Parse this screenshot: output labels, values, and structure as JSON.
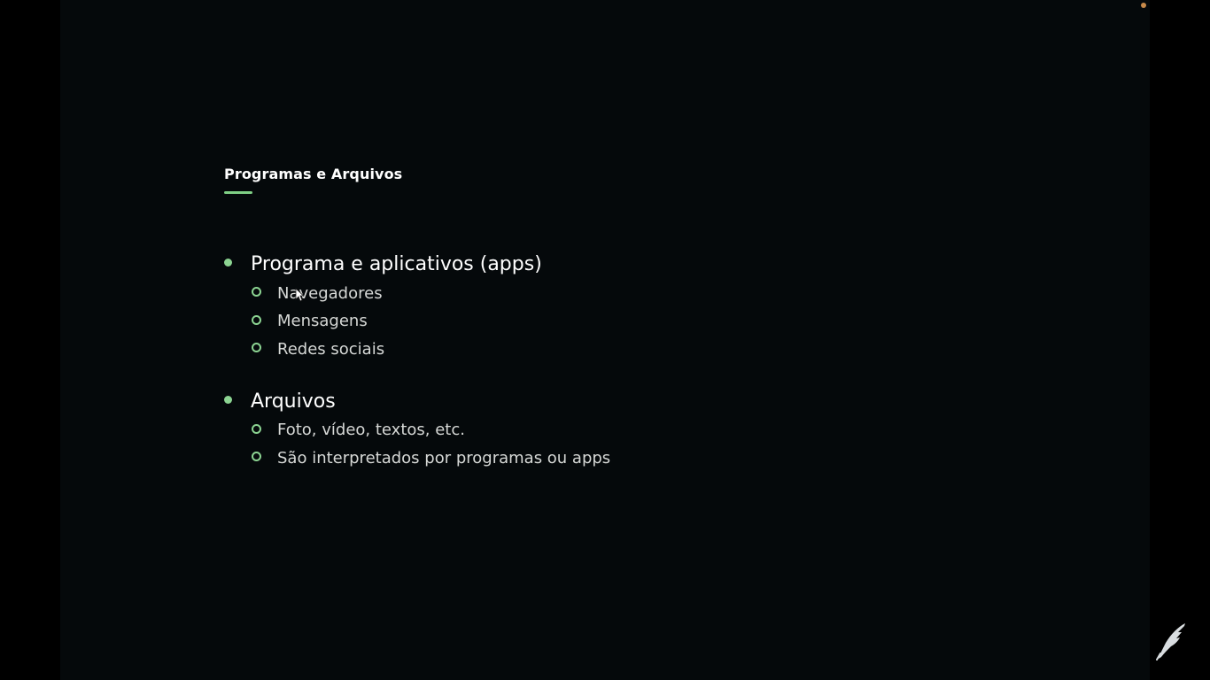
{
  "slide": {
    "title": "Programas e Arquivos",
    "sections": [
      {
        "label": "Programa e aplicativos (apps)",
        "items": [
          "Navegadores",
          "Mensagens",
          "Redes sociais"
        ]
      },
      {
        "label": "Arquivos",
        "items": [
          "Foto, vídeo, textos, etc.",
          "São interpretados por programas ou apps"
        ]
      }
    ]
  },
  "colors": {
    "background": "#05090b",
    "accent": "#8cd492",
    "title": "#ffffff",
    "subtext": "#d6d8d6"
  },
  "icons": {
    "cursor": "mouse-pointer-icon",
    "watermark": "feather-quill-icon"
  }
}
